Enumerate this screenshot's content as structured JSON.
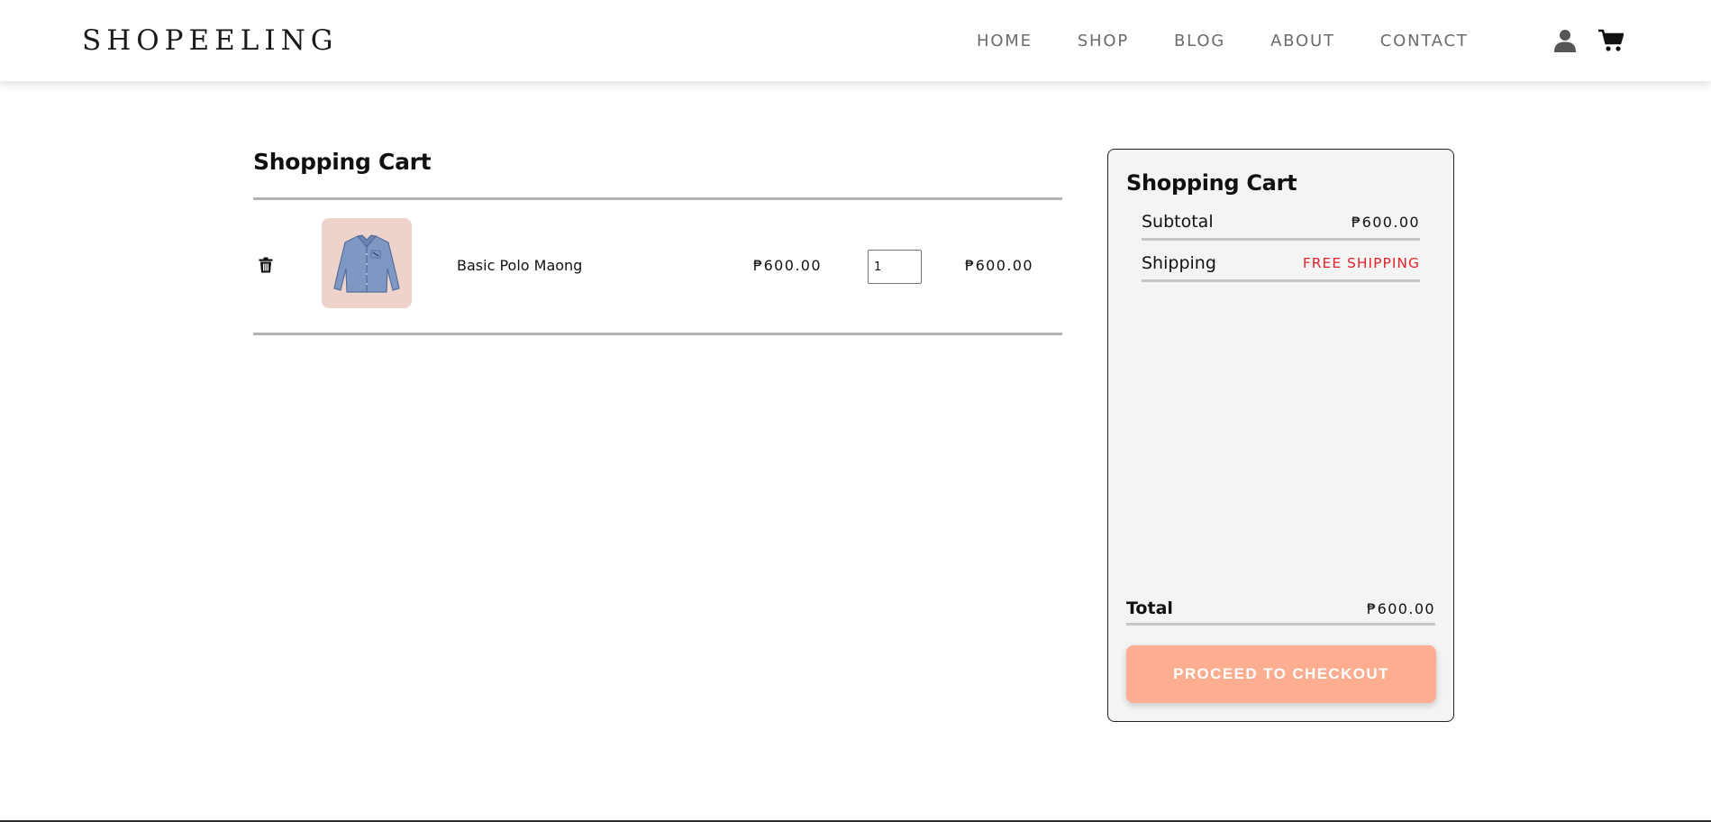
{
  "brand": "SHOPEELING",
  "nav": {
    "items": [
      "HOME",
      "SHOP",
      "BLOG",
      "ABOUT",
      "CONTACT"
    ],
    "icons": [
      "user-icon",
      "cart-icon"
    ]
  },
  "cart": {
    "title": "Shopping Cart",
    "items": [
      {
        "name": "Basic Polo Maong",
        "price": "₱600.00",
        "quantity": "1",
        "total": "₱600.00",
        "image": "denim shirt"
      }
    ]
  },
  "summary": {
    "title": "Shopping Cart",
    "subtotal_label": "Subtotal",
    "subtotal_value": "₱600.00",
    "shipping_label": "Shipping",
    "shipping_value": "FREE SHIPPING",
    "total_label": "Total",
    "total_value": "₱600.00",
    "checkout_label": "PROCEED TO CHECKOUT"
  },
  "colors": {
    "accent": "#fdad90",
    "free_shipping": "#e0242a",
    "thumb_bg": "#eed3cc",
    "panel_bg": "#f4f4f4"
  }
}
